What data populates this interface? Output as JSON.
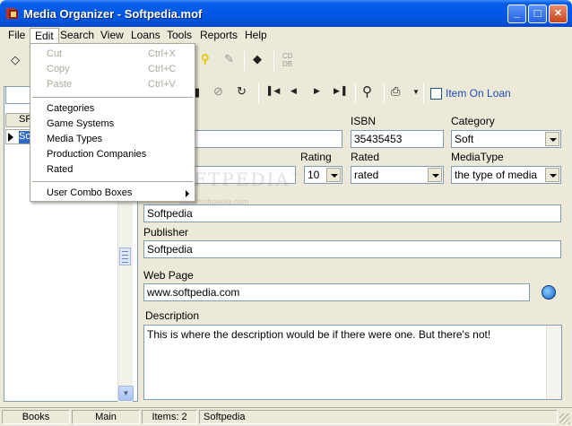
{
  "window": {
    "title": "Media Organizer - Softpedia.mof",
    "buttons": {
      "minimize": "_",
      "maximize": "□",
      "close": "✕"
    }
  },
  "menubar": [
    "File",
    "Edit",
    "Search",
    "View",
    "Loans",
    "Tools",
    "Reports",
    "Help"
  ],
  "edit_menu": {
    "items": [
      {
        "label": "Cut",
        "shortcut": "Ctrl+X",
        "enabled": false
      },
      {
        "label": "Copy",
        "shortcut": "Ctrl+C",
        "enabled": false
      },
      {
        "label": "Paste",
        "shortcut": "Ctrl+V",
        "enabled": false
      },
      {
        "label": "Categories",
        "enabled": true
      },
      {
        "label": "Game Systems",
        "enabled": true
      },
      {
        "label": "Media Types",
        "enabled": true
      },
      {
        "label": "Production Companies",
        "enabled": true
      },
      {
        "label": "Rated",
        "enabled": true
      },
      {
        "label": "User Combo Boxes",
        "enabled": true,
        "submenu": true
      }
    ]
  },
  "toolbar": {
    "item_on_loan_label": "Item On Loan",
    "item_on_loan_checked": false
  },
  "left_list": {
    "header": "SF",
    "selected_row": "So"
  },
  "form": {
    "isbn_label": "ISBN",
    "isbn_value": "35435453",
    "category_label": "Category",
    "category_value": "Soft",
    "rating_label": "Rating",
    "rating_value": "10",
    "rated_label": "Rated",
    "rated_value": "rated",
    "mediatype_label": "MediaType",
    "mediatype_value": "the type of media",
    "author_value": "Softpedia",
    "publisher_label": "Publisher",
    "publisher_value": "Softpedia",
    "webpage_label": "Web Page",
    "webpage_value": "www.softpedia.com",
    "description_label": "Description",
    "description_value": "This is where the description would be if there were one. But there's not!"
  },
  "statusbar": [
    "Books",
    "Main",
    "Items: 2",
    "Softpedia"
  ],
  "watermark": {
    "text": "SOFTPEDIA",
    "mark": "™",
    "url": "www.softpedia.com"
  }
}
